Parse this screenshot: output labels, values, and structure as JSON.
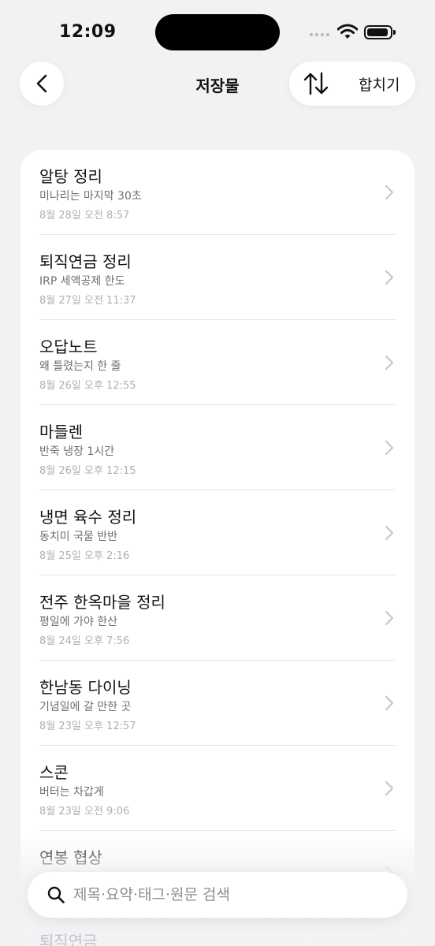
{
  "status_bar": {
    "time": "12:09"
  },
  "nav": {
    "title": "저장물",
    "merge_label": "합치기"
  },
  "items": [
    {
      "title": "알탕 정리",
      "summary": "미나리는 마지막 30초",
      "date": "8월 28일 오전 8:57"
    },
    {
      "title": "퇴직연금 정리",
      "summary": "IRP 세액공제 한도",
      "date": "8월 27일 오전 11:37"
    },
    {
      "title": "오답노트",
      "summary": "왜 틀렸는지 한 줄",
      "date": "8월 26일 오후 12:55"
    },
    {
      "title": "마들렌",
      "summary": "반죽 냉장 1시간",
      "date": "8월 26일 오후 12:15"
    },
    {
      "title": "냉면 육수 정리",
      "summary": "동치미 국물 반반",
      "date": "8월 25일 오후 2:16"
    },
    {
      "title": "전주 한옥마을 정리",
      "summary": "평일에 가야 한산",
      "date": "8월 24일 오후 7:56"
    },
    {
      "title": "한남동 다이닝",
      "summary": "기념일에 갈 만한 곳",
      "date": "8월 23일 오후 12:57"
    },
    {
      "title": "스콘",
      "summary": "버터는 차갑게",
      "date": "8월 23일 오전 9:06"
    },
    {
      "title": "연봉 협상",
      "summary": "",
      "date": ""
    }
  ],
  "below_fold_title": "퇴직연금",
  "search": {
    "placeholder": "제목·요약·태그·원문 검색"
  }
}
